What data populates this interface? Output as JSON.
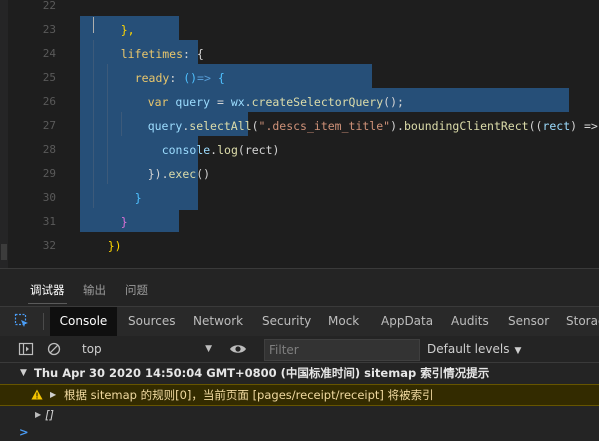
{
  "editor": {
    "line_numbers": [
      "22",
      "23",
      "24",
      "25",
      "26",
      "27",
      "28",
      "29",
      "30",
      "31",
      "32"
    ],
    "lines": {
      "l22": "},",
      "l23_key": "lifetimes",
      "l23_rest": ": {",
      "l24_key": "ready",
      "l24_rest": ": ",
      "l24_parens": "()",
      "l24_arrow": "=>",
      "l24_brace": " {",
      "l25_var": "var",
      "l25_name": " query",
      "l25_eq": " = ",
      "l25_obj": "wx",
      "l25_dot": ".",
      "l25_fn": "createSelectorQuery",
      "l25_end": "();",
      "l26_obj": "query",
      "l26_dot": ".",
      "l26_fn1": "selectAll",
      "l26_open": "(",
      "l26_str": "\".descs_item_title\"",
      "l26_close": ")",
      "l26_dot2": ".",
      "l26_fn2": "boundingClientRect",
      "l26_args": "((",
      "l26_param": "rect",
      "l26_arrow": ") => {",
      "l27_obj": "console",
      "l27_dot": ".",
      "l27_fn": "log",
      "l27_args": "(rect)",
      "l28_close": "})",
      "l28_dot": ".",
      "l28_fn": "exec",
      "l28_end": "()",
      "l29": "}",
      "l30": "}",
      "l31": "})"
    }
  },
  "panel": {
    "tabs": [
      "调试器",
      "输出",
      "问题"
    ],
    "devtools_tabs": [
      "Console",
      "Sources",
      "Network",
      "Security",
      "Mock",
      "AppData",
      "Audits",
      "Sensor",
      "Storag"
    ],
    "context": "top",
    "filter_placeholder": "Filter",
    "levels_label": "Default levels"
  },
  "console": {
    "group_text": "Thu Apr 30 2020 14:50:04 GMT+0800 (中国标准时间) sitemap 索引情况提示",
    "warn_text": "根据 sitemap 的规则[0]，当前页面 [pages/receipt/receipt] 将被索引",
    "array_text": "[]",
    "prompt_symbol": ">"
  },
  "icons": {
    "inspect": "inspect-element-icon",
    "sidebar": "sidebar-toggle-icon",
    "clear": "clear-console-icon",
    "eye": "eye-icon",
    "warning": "warning-icon"
  },
  "colors": {
    "selection": "#264f78",
    "keyword": "#569cd6",
    "function": "#dcdcaa",
    "string": "#ce9178",
    "warning_bg": "#332b00"
  }
}
